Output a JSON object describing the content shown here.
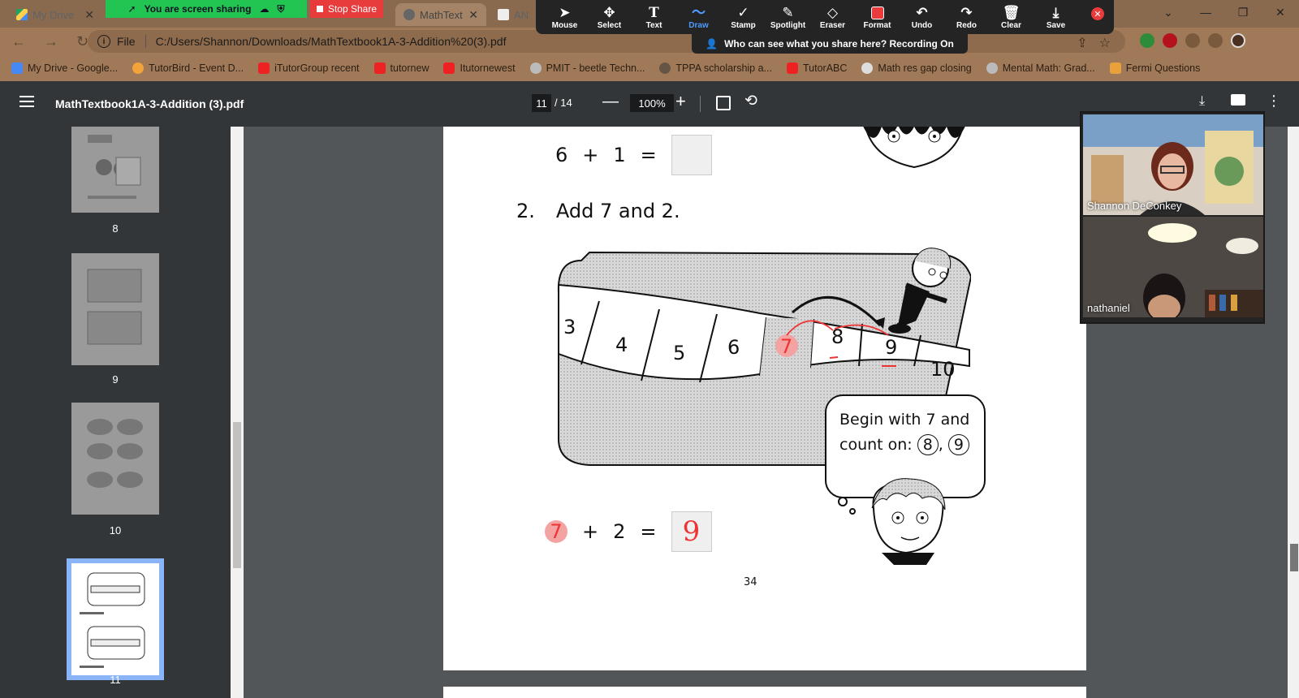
{
  "browser": {
    "tabs": [
      {
        "label": "My Drive",
        "icon": "google-drive-icon"
      },
      {
        "label": "MathText",
        "icon": "chrome-icon"
      },
      {
        "label": "AN",
        "icon": "doc-icon"
      }
    ],
    "address": {
      "scheme": "File",
      "url": "C:/Users/Shannon/Downloads/MathTextbook1A-3-Addition%20(3).pdf"
    },
    "bookmarks": [
      {
        "label": "My Drive - Google..."
      },
      {
        "label": "TutorBird - Event D..."
      },
      {
        "label": "iTutorGroup recent"
      },
      {
        "label": "tutornew"
      },
      {
        "label": "Itutornewest"
      },
      {
        "label": "PMIT - beetle Techn..."
      },
      {
        "label": "TPPA scholarship a..."
      },
      {
        "label": "TutorABC"
      },
      {
        "label": "Math res gap closing"
      },
      {
        "label": "Mental Math: Grad..."
      },
      {
        "label": "Fermi Questions"
      }
    ]
  },
  "zoom_share": {
    "sharing_label": "You are screen sharing",
    "stop_label": "Stop Share",
    "recording_banner": "Who can see what you share here? Recording On",
    "tools": [
      {
        "label": "Mouse",
        "icon": "cursor-icon"
      },
      {
        "label": "Select",
        "icon": "move-icon"
      },
      {
        "label": "Text",
        "icon": "text-icon"
      },
      {
        "label": "Draw",
        "icon": "draw-icon",
        "active": true
      },
      {
        "label": "Stamp",
        "icon": "check-icon"
      },
      {
        "label": "Spotlight",
        "icon": "spotlight-icon"
      },
      {
        "label": "Eraser",
        "icon": "eraser-icon"
      },
      {
        "label": "Format",
        "icon": "format-icon"
      },
      {
        "label": "Undo",
        "icon": "undo-icon"
      },
      {
        "label": "Redo",
        "icon": "redo-icon"
      },
      {
        "label": "Clear",
        "icon": "trash-icon"
      },
      {
        "label": "Save",
        "icon": "save-icon"
      }
    ]
  },
  "pdf": {
    "title": "MathTextbook1A-3-Addition (3).pdf",
    "current_page": "11",
    "total_pages": "/ 14",
    "zoom": "100%",
    "thumbnails": [
      {
        "num": "8"
      },
      {
        "num": "9"
      },
      {
        "num": "10"
      },
      {
        "num": "11"
      }
    ]
  },
  "page_content": {
    "eq1": {
      "a": "6",
      "op": "+",
      "b": "1",
      "eq": "="
    },
    "question": {
      "number": "2.",
      "text": "Add 7 and 2."
    },
    "number_line": [
      "3",
      "4",
      "5",
      "6",
      "7",
      "8",
      "9",
      "10"
    ],
    "bubble": {
      "line1": "Begin with 7 and",
      "line2": "count on:",
      "c1": "8",
      "comma": ",",
      "c2": "9"
    },
    "eq2": {
      "a": "7",
      "op": "+",
      "b": "2",
      "eq": "=",
      "answer": "9"
    },
    "page_number": "34"
  },
  "participants": [
    {
      "name": "Shannon DeConkey"
    },
    {
      "name": "nathaniel"
    }
  ]
}
